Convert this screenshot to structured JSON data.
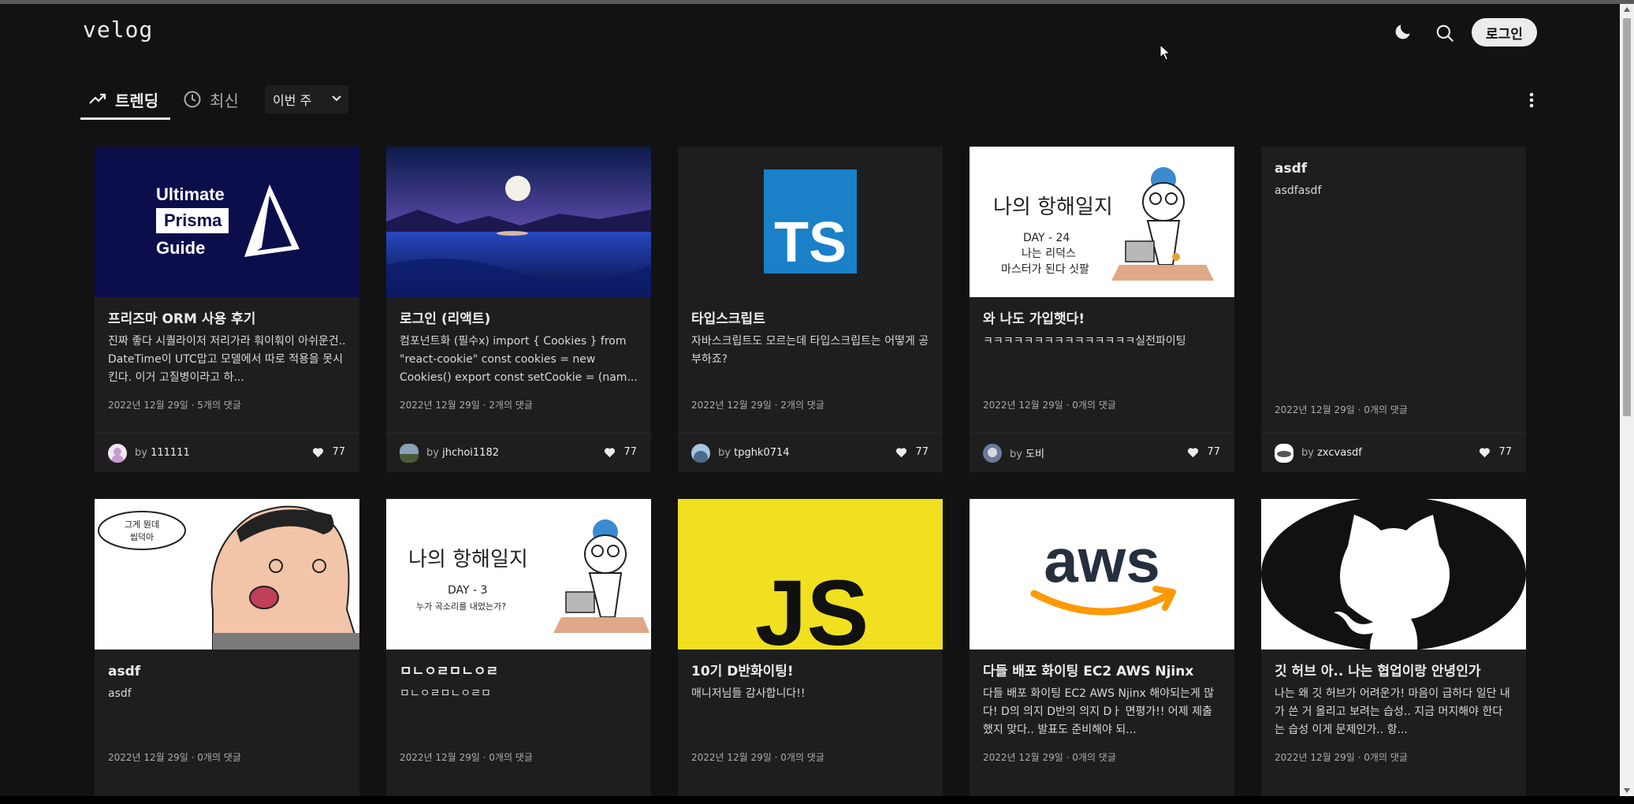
{
  "header": {
    "logo": "velog",
    "login_label": "로그인"
  },
  "tabs": {
    "trending_label": "트렌딩",
    "recent_label": "최신",
    "period_value": "이번 주"
  },
  "icons": {
    "theme": "moon-icon",
    "search": "search-icon",
    "more": "more-vertical-icon",
    "like": "heart-icon",
    "trending": "trending-up-icon",
    "recent": "clock-icon"
  },
  "colors": {
    "background": "#121212",
    "card": "#1e1e1e",
    "text": "#ececec",
    "muted": "#acacac"
  },
  "posts": [
    {
      "title": "프리즈마 ORM 사용 후기",
      "description": "진짜 좋다 시퀄라이저 저리가라 훠이훠이 아쉬운건.. DateTime이 UTC맙고 모델에서 따로 적용을 못시킨다. 이거 고질병이라고 하...",
      "meta": "2022년 12월 29일 · 5개의 댓글",
      "author_prefix": "by",
      "author": "111111",
      "likes": "77",
      "thumb_text": [
        "Ultimate",
        "Prisma",
        "Guide"
      ]
    },
    {
      "title": "로그인 (리액트)",
      "description": "컴포넌트화 (필수x) import { Cookies } from \"react-cookie\" const cookies = new Cookies() export const setCookie = (nam...",
      "meta": "2022년 12월 29일 · 2개의 댓글",
      "author_prefix": "by",
      "author": "jhchoi1182",
      "likes": "77"
    },
    {
      "title": "타입스크립트",
      "description": "자바스크립트도 모르는데 타입스크립트는 어떻게 공부하죠?",
      "meta": "2022년 12월 29일 · 2개의 댓글",
      "author_prefix": "by",
      "author": "tpghk0714",
      "likes": "77",
      "thumb_text": [
        "TS"
      ]
    },
    {
      "title": "와 나도 가입햇다!",
      "description": "ㅋㅋㅋㅋㅋㅋㅋㅋㅋㅋㅋㅋㅋㅋㅋ실전파이팅",
      "meta": "2022년 12월 29일 · 0개의 댓글",
      "author_prefix": "by",
      "author": "도비",
      "likes": "77",
      "thumb_text": [
        "나의 항해일지",
        "DAY - 24",
        "나는 리덕스",
        "마스터가 된다 싯팔"
      ]
    },
    {
      "title": "asdf",
      "description": "asdfasdf",
      "meta": "2022년 12월 29일 · 0개의 댓글",
      "author_prefix": "by",
      "author": "zxcvasdf",
      "likes": "77"
    },
    {
      "title": "asdf",
      "description": "asdf",
      "meta": "2022년 12월 29일 · 0개의 댓글",
      "thumb_text": [
        "그게 뭔데",
        "씹덕아"
      ]
    },
    {
      "title": "ㅁㄴㅇㄹㅁㄴㅇㄹ",
      "description": "ㅁㄴㅇㄹㅁㄴㅇㄹㅁ",
      "meta": "2022년 12월 29일 · 0개의 댓글",
      "thumb_text": [
        "나의 항해일지",
        "DAY - 3",
        "누가 곡소리를 내었는가?"
      ]
    },
    {
      "title": "10기 D반화이팅!",
      "description": "매니저님들 감사합니다!!",
      "meta": "2022년 12월 29일 · 0개의 댓글",
      "thumb_text": [
        "JS"
      ]
    },
    {
      "title": "다들 배포 화이팅 EC2 AWS Njinx",
      "description": "다들 배포 화이팅 EC2 AWS Njinx 해야되는게 많다! D의 의지 D반의 의지 Dㅏ 면평가!! 어제 제출했지 맞다.. 발표도 준비해야 되...",
      "meta": "2022년 12월 29일 · 0개의 댓글",
      "thumb_text": [
        "aws"
      ]
    },
    {
      "title": "깃 허브 아.. 나는 협업이랑 안녕인가",
      "description": "나는 왜 깃 허브가 어려운가! 마음이 급하다 일단 내가 쓴 거 올리고 보려는 습성.. 지금 머지해야 한다는 습성 이게 문제인가.. 항...",
      "meta": "2022년 12월 29일 · 0개의 댓글"
    }
  ]
}
